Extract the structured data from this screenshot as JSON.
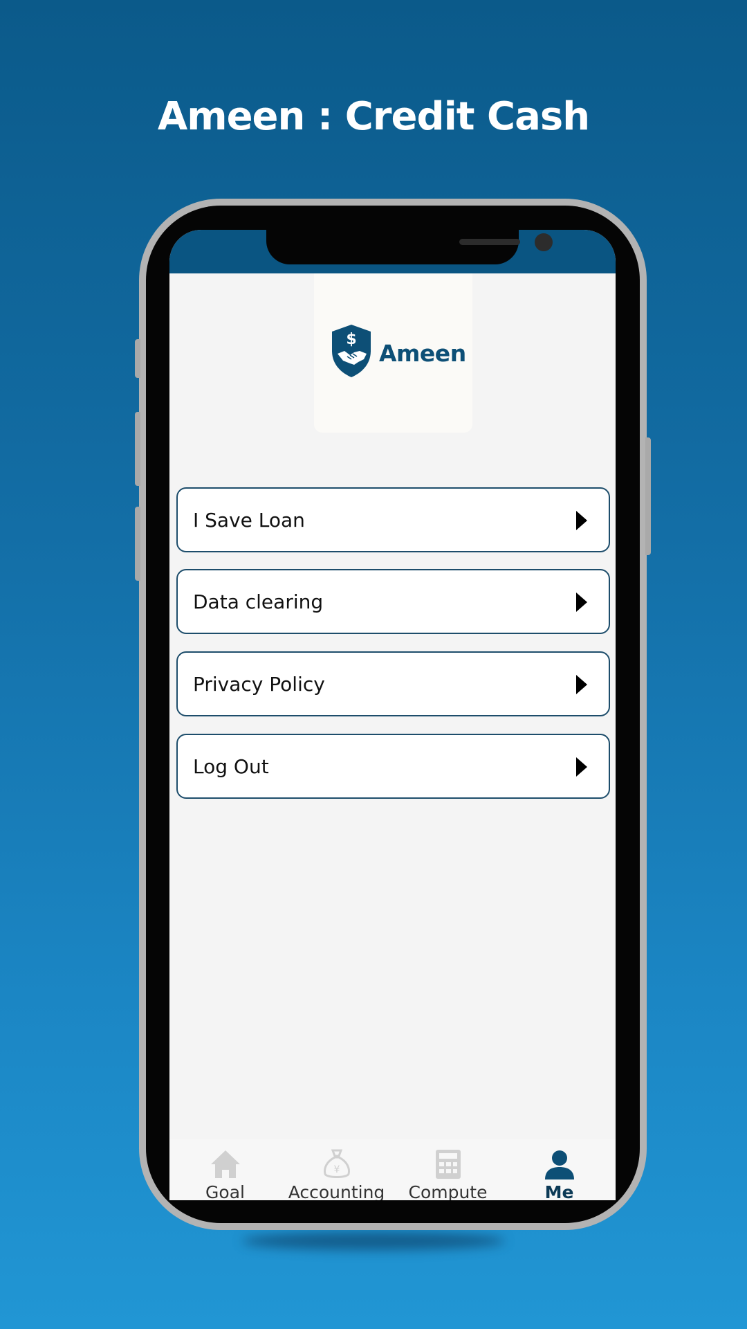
{
  "promo": {
    "title": "Ameen : Credit Cash"
  },
  "app": {
    "logo_text": "Ameen"
  },
  "menu": {
    "items": [
      {
        "label": "I Save Loan"
      },
      {
        "label": "Data clearing"
      },
      {
        "label": "Privacy Policy"
      },
      {
        "label": "Log Out"
      }
    ]
  },
  "tabbar": {
    "tabs": [
      {
        "label": "Goal",
        "icon": "home-icon",
        "active": false
      },
      {
        "label": "Accounting",
        "icon": "money-bag-icon",
        "active": false
      },
      {
        "label": "Compute",
        "icon": "calculator-icon",
        "active": false
      },
      {
        "label": "Me",
        "icon": "person-icon",
        "active": true
      }
    ]
  },
  "colors": {
    "brand": "#0d4f76",
    "background_top": "#0b5a8a",
    "background_bottom": "#2196d4",
    "menu_border": "#1d4d6b",
    "inactive_icon": "#d0d0d0"
  }
}
